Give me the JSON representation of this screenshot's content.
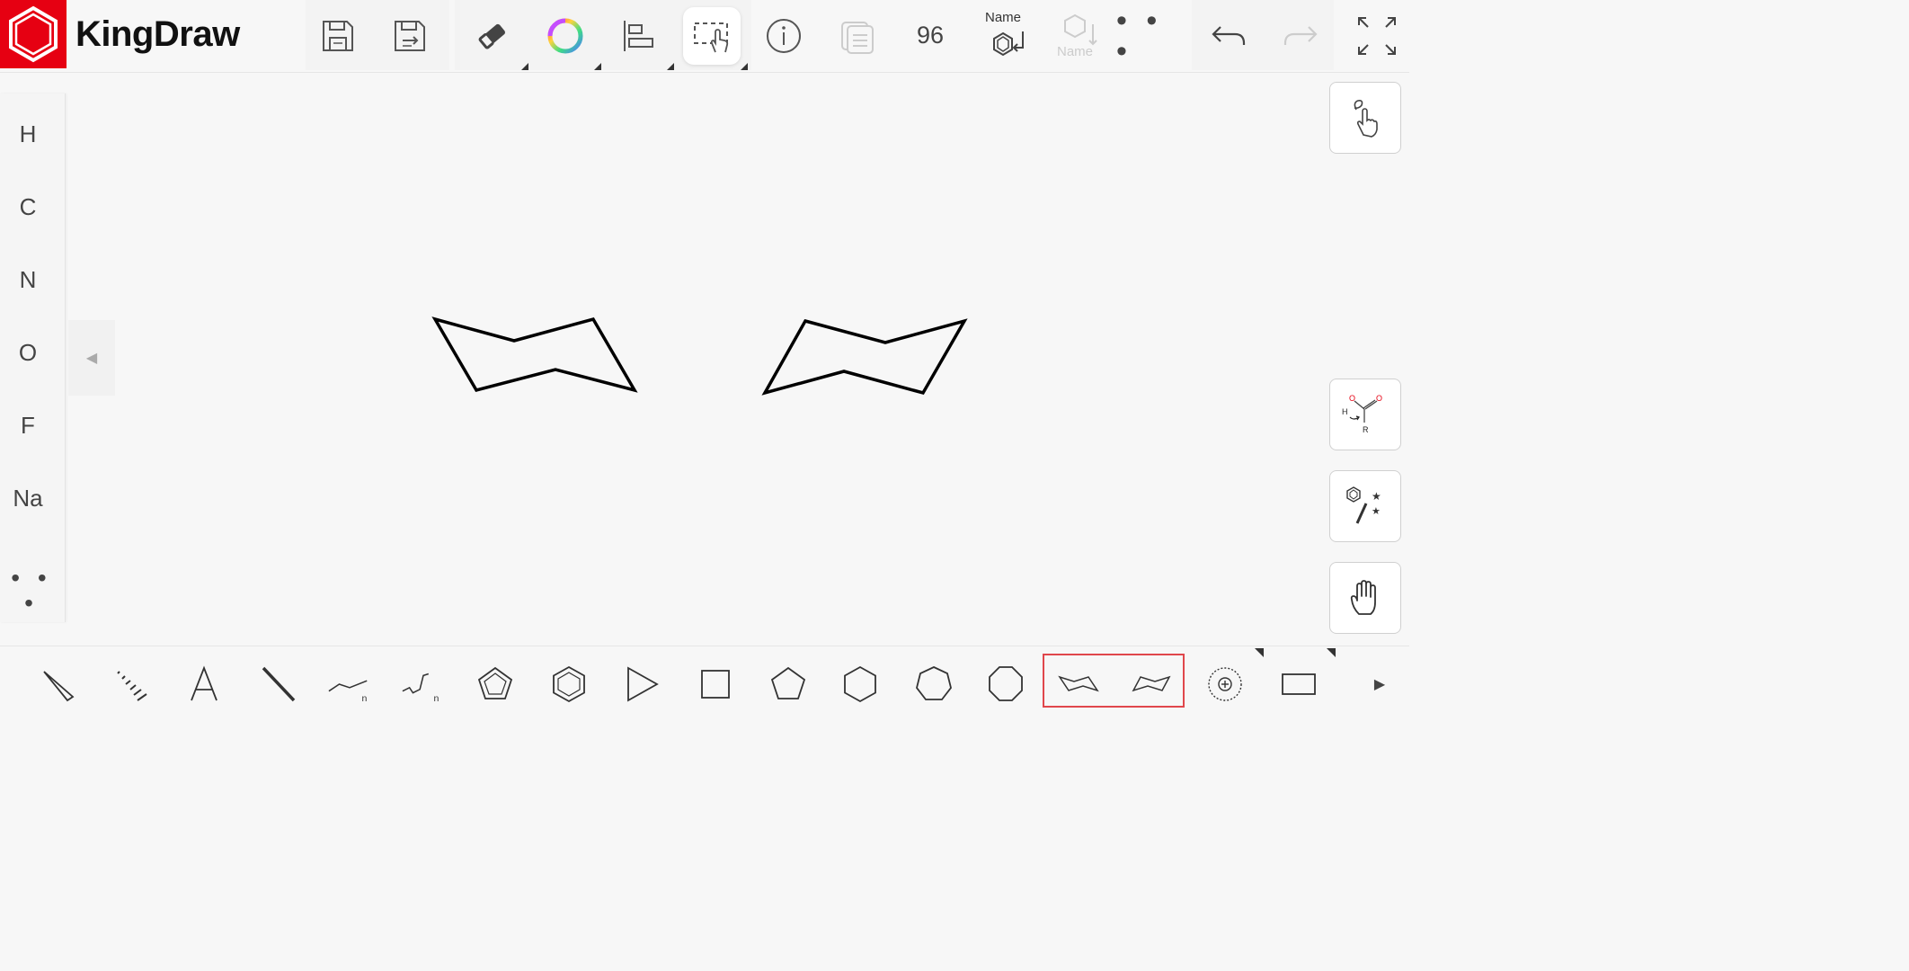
{
  "app": {
    "title": "KingDraw"
  },
  "toolbar": {
    "zoom": "96",
    "name_label": "Name",
    "name_disabled_label": "Name",
    "more_label": "• • •"
  },
  "sidebar": {
    "elements": [
      "H",
      "C",
      "N",
      "O",
      "F",
      "Na"
    ],
    "more_label": "• • •"
  },
  "canvas": {
    "collapse_arrow": "◀"
  },
  "bottom": {
    "next_arrow": "▶"
  },
  "colors": {
    "brand": "#e60012",
    "highlight": "#e0474c"
  }
}
